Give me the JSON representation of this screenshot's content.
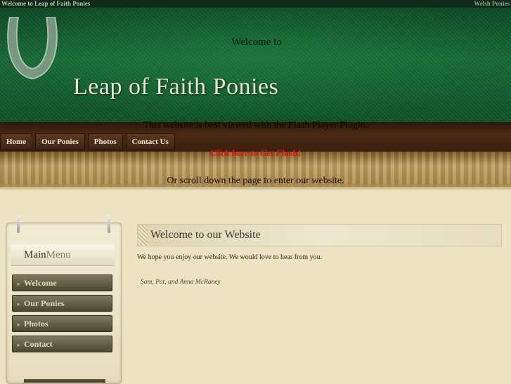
{
  "topbar": {
    "left_text": "Welcome to Leap of Faith Ponies",
    "right_text": "Welsh Ponies"
  },
  "header": {
    "welcome_to": "Welcome to",
    "site_title": "Leap of Faith Ponies"
  },
  "flash": {
    "notice": "This website is best viewed with the Flash Player Plugin.",
    "link_text": "Click here to Get Flash!",
    "scroll_note": "Or scroll down the page to enter our website."
  },
  "nav": {
    "items": [
      "Home",
      "Our Ponies",
      "Photos",
      "Contact Us"
    ]
  },
  "menu": {
    "title_main": "Main",
    "title_sub": "Menu",
    "items": [
      "Welcome",
      "Our Ponies",
      "Photos",
      "Contact"
    ]
  },
  "content": {
    "heading": "Welcome to our Website",
    "intro": "We hope you enjoy our website. We would love to hear from you.",
    "signature": "Sam, Pat, and Anna McRaney"
  },
  "colors": {
    "header_green": "#176a35",
    "nav_brown": "#4a2a14",
    "flash_link_red": "#e51010",
    "parchment": "#ece3c2"
  }
}
